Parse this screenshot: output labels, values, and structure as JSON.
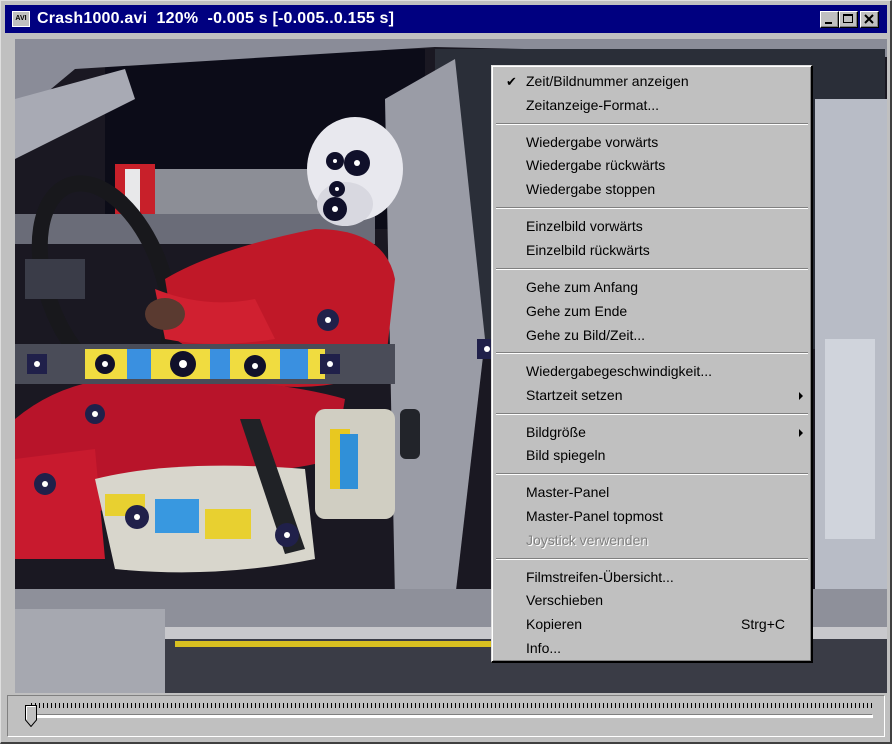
{
  "window": {
    "title": "Crash1000.avi  120%  -0.005 s [-0.005..0.155 s]",
    "app_icon_text": "AVI",
    "icons": [
      "app-icon",
      "minimize-icon",
      "maximize-icon",
      "close-icon"
    ]
  },
  "menu": {
    "items": [
      {
        "label": "Zeit/Bildnummer anzeigen",
        "checked": true
      },
      {
        "label": "Zeitanzeige-Format..."
      },
      {
        "label": "Wiedergabe vorwärts"
      },
      {
        "label": "Wiedergabe rückwärts"
      },
      {
        "label": "Wiedergabe stoppen"
      },
      {
        "label": "Einzelbild vorwärts"
      },
      {
        "label": "Einzelbild rückwärts"
      },
      {
        "label": "Gehe zum Anfang"
      },
      {
        "label": "Gehe zum Ende"
      },
      {
        "label": "Gehe zu Bild/Zeit..."
      },
      {
        "label": "Wiedergabegeschwindigkeit..."
      },
      {
        "label": "Startzeit setzen",
        "submenu": true
      },
      {
        "label": "Bildgröße",
        "submenu": true
      },
      {
        "label": "Bild spiegeln"
      },
      {
        "label": "Master-Panel"
      },
      {
        "label": "Master-Panel topmost"
      },
      {
        "label": "Joystick verwenden",
        "disabled": true
      },
      {
        "label": "Filmstreifen-Übersicht..."
      },
      {
        "label": "Verschieben"
      },
      {
        "label": "Kopieren",
        "shortcut": "Strg+C"
      },
      {
        "label": "Info..."
      }
    ]
  },
  "slider": {
    "position": 0
  }
}
